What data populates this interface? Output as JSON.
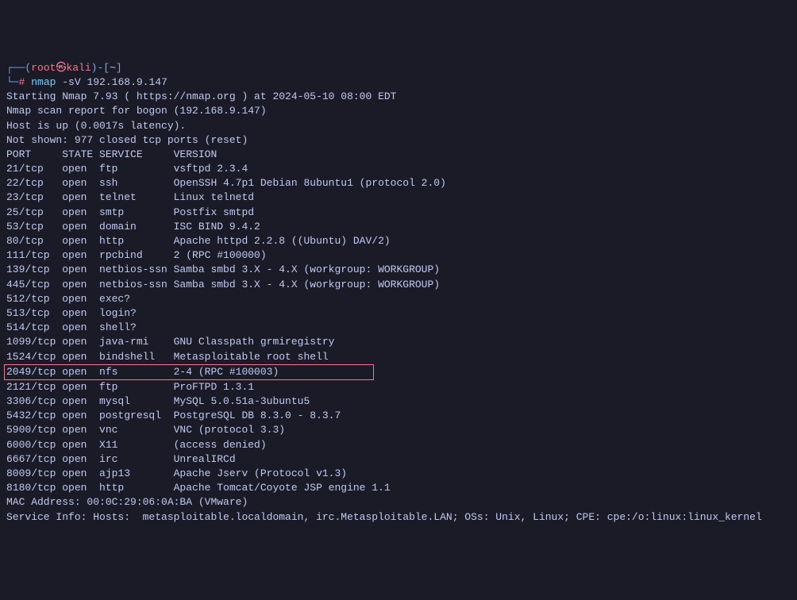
{
  "prompt1": {
    "dash1": "┌──",
    "paren_open": "(",
    "root": "root",
    "at": "㉿",
    "host": "kali",
    "paren_close": ")",
    "dash2": "-",
    "bracket_open": "[",
    "tilde": "~",
    "bracket_close": "]"
  },
  "prompt2": {
    "dash": "└─",
    "hash": "#",
    "cmd": "nmap",
    "args": " -sV 192.168.9.147"
  },
  "output": {
    "l1": "Starting Nmap 7.93 ( https://nmap.org ) at 2024-05-10 08:00 EDT",
    "l2": "Nmap scan report for bogon (192.168.9.147)",
    "l3": "Host is up (0.0017s latency).",
    "l4": "Not shown: 977 closed tcp ports (reset)",
    "l5": "PORT     STATE SERVICE     VERSION",
    "l6": "21/tcp   open  ftp         vsftpd 2.3.4",
    "l7": "22/tcp   open  ssh         OpenSSH 4.7p1 Debian 8ubuntu1 (protocol 2.0)",
    "l8": "23/tcp   open  telnet      Linux telnetd",
    "l9": "25/tcp   open  smtp        Postfix smtpd",
    "l10": "53/tcp   open  domain      ISC BIND 9.4.2",
    "l11": "80/tcp   open  http        Apache httpd 2.2.8 ((Ubuntu) DAV/2)",
    "l12": "111/tcp  open  rpcbind     2 (RPC #100000)",
    "l13": "139/tcp  open  netbios-ssn Samba smbd 3.X - 4.X (workgroup: WORKGROUP)",
    "l14": "445/tcp  open  netbios-ssn Samba smbd 3.X - 4.X (workgroup: WORKGROUP)",
    "l15": "512/tcp  open  exec?",
    "l16": "513/tcp  open  login?",
    "l17": "514/tcp  open  shell?",
    "l18": "1099/tcp open  java-rmi    GNU Classpath grmiregistry",
    "l19": "1524/tcp open  bindshell   Metasploitable root shell",
    "l20": "2049/tcp open  nfs         2-4 (RPC #100003)",
    "l21": "2121/tcp open  ftp         ProFTPD 1.3.1",
    "l22": "3306/tcp open  mysql       MySQL 5.0.51a-3ubuntu5",
    "l23": "5432/tcp open  postgresql  PostgreSQL DB 8.3.0 - 8.3.7",
    "l24": "5900/tcp open  vnc         VNC (protocol 3.3)",
    "l25": "6000/tcp open  X11         (access denied)",
    "l26": "6667/tcp open  irc         UnrealIRCd",
    "l27": "8009/tcp open  ajp13       Apache Jserv (Protocol v1.3)",
    "l28": "8180/tcp open  http        Apache Tomcat/Coyote JSP engine 1.1",
    "l29": "MAC Address: 00:0C:29:06:0A:BA (VMware)",
    "l30": "Service Info: Hosts:  metasploitable.localdomain, irc.Metasploitable.LAN; OSs: Unix, Linux; CPE: cpe:/o:linux:linux_kernel"
  }
}
